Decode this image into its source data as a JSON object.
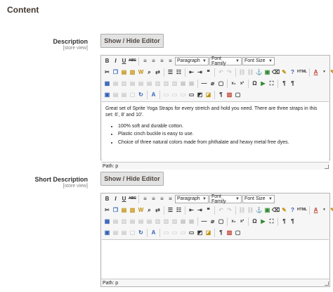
{
  "section": {
    "title": "Content"
  },
  "description": {
    "label": "Description",
    "scope": "[store view]",
    "toggle_label": "Show / Hide Editor",
    "content": {
      "paragraph": "Great set of Sprite Yoga Straps for every stretch and hold you need. There are three straps in this set: 6', 8' and 10'.",
      "bullets": [
        "100% soft and durable cotton.",
        "Plastic cinch buckle is easy to use.",
        "Choice of three natural colors made from phthalate and heavy metal free dyes."
      ]
    },
    "path": "Path: p"
  },
  "short_description": {
    "label": "Short Description",
    "scope": "[store view]",
    "toggle_label": "Show / Hide Editor",
    "path": "Path: p"
  },
  "toolbar": {
    "format_select": "Paragraph",
    "font_family_select": "Font Family",
    "font_size_select": "Font Size",
    "bold": "B",
    "italic": "I",
    "underline": "U",
    "strike": "ABC",
    "subscript": "x₂",
    "superscript": "x²",
    "html": "HTML",
    "text_color": "A",
    "pilcrow": "¶"
  }
}
